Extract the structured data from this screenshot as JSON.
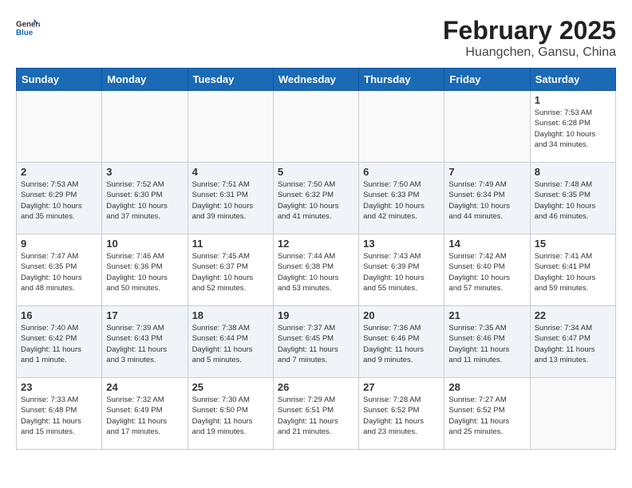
{
  "header": {
    "logo_general": "General",
    "logo_blue": "Blue",
    "month_title": "February 2025",
    "location": "Huangchen, Gansu, China"
  },
  "weekdays": [
    "Sunday",
    "Monday",
    "Tuesday",
    "Wednesday",
    "Thursday",
    "Friday",
    "Saturday"
  ],
  "weeks": [
    [
      {
        "day": "",
        "info": ""
      },
      {
        "day": "",
        "info": ""
      },
      {
        "day": "",
        "info": ""
      },
      {
        "day": "",
        "info": ""
      },
      {
        "day": "",
        "info": ""
      },
      {
        "day": "",
        "info": ""
      },
      {
        "day": "1",
        "info": "Sunrise: 7:53 AM\nSunset: 6:28 PM\nDaylight: 10 hours\nand 34 minutes."
      }
    ],
    [
      {
        "day": "2",
        "info": "Sunrise: 7:53 AM\nSunset: 6:29 PM\nDaylight: 10 hours\nand 35 minutes."
      },
      {
        "day": "3",
        "info": "Sunrise: 7:52 AM\nSunset: 6:30 PM\nDaylight: 10 hours\nand 37 minutes."
      },
      {
        "day": "4",
        "info": "Sunrise: 7:51 AM\nSunset: 6:31 PM\nDaylight: 10 hours\nand 39 minutes."
      },
      {
        "day": "5",
        "info": "Sunrise: 7:50 AM\nSunset: 6:32 PM\nDaylight: 10 hours\nand 41 minutes."
      },
      {
        "day": "6",
        "info": "Sunrise: 7:50 AM\nSunset: 6:33 PM\nDaylight: 10 hours\nand 42 minutes."
      },
      {
        "day": "7",
        "info": "Sunrise: 7:49 AM\nSunset: 6:34 PM\nDaylight: 10 hours\nand 44 minutes."
      },
      {
        "day": "8",
        "info": "Sunrise: 7:48 AM\nSunset: 6:35 PM\nDaylight: 10 hours\nand 46 minutes."
      }
    ],
    [
      {
        "day": "9",
        "info": "Sunrise: 7:47 AM\nSunset: 6:35 PM\nDaylight: 10 hours\nand 48 minutes."
      },
      {
        "day": "10",
        "info": "Sunrise: 7:46 AM\nSunset: 6:36 PM\nDaylight: 10 hours\nand 50 minutes."
      },
      {
        "day": "11",
        "info": "Sunrise: 7:45 AM\nSunset: 6:37 PM\nDaylight: 10 hours\nand 52 minutes."
      },
      {
        "day": "12",
        "info": "Sunrise: 7:44 AM\nSunset: 6:38 PM\nDaylight: 10 hours\nand 53 minutes."
      },
      {
        "day": "13",
        "info": "Sunrise: 7:43 AM\nSunset: 6:39 PM\nDaylight: 10 hours\nand 55 minutes."
      },
      {
        "day": "14",
        "info": "Sunrise: 7:42 AM\nSunset: 6:40 PM\nDaylight: 10 hours\nand 57 minutes."
      },
      {
        "day": "15",
        "info": "Sunrise: 7:41 AM\nSunset: 6:41 PM\nDaylight: 10 hours\nand 59 minutes."
      }
    ],
    [
      {
        "day": "16",
        "info": "Sunrise: 7:40 AM\nSunset: 6:42 PM\nDaylight: 11 hours\nand 1 minute."
      },
      {
        "day": "17",
        "info": "Sunrise: 7:39 AM\nSunset: 6:43 PM\nDaylight: 11 hours\nand 3 minutes."
      },
      {
        "day": "18",
        "info": "Sunrise: 7:38 AM\nSunset: 6:44 PM\nDaylight: 11 hours\nand 5 minutes."
      },
      {
        "day": "19",
        "info": "Sunrise: 7:37 AM\nSunset: 6:45 PM\nDaylight: 11 hours\nand 7 minutes."
      },
      {
        "day": "20",
        "info": "Sunrise: 7:36 AM\nSunset: 6:46 PM\nDaylight: 11 hours\nand 9 minutes."
      },
      {
        "day": "21",
        "info": "Sunrise: 7:35 AM\nSunset: 6:46 PM\nDaylight: 11 hours\nand 11 minutes."
      },
      {
        "day": "22",
        "info": "Sunrise: 7:34 AM\nSunset: 6:47 PM\nDaylight: 11 hours\nand 13 minutes."
      }
    ],
    [
      {
        "day": "23",
        "info": "Sunrise: 7:33 AM\nSunset: 6:48 PM\nDaylight: 11 hours\nand 15 minutes."
      },
      {
        "day": "24",
        "info": "Sunrise: 7:32 AM\nSunset: 6:49 PM\nDaylight: 11 hours\nand 17 minutes."
      },
      {
        "day": "25",
        "info": "Sunrise: 7:30 AM\nSunset: 6:50 PM\nDaylight: 11 hours\nand 19 minutes."
      },
      {
        "day": "26",
        "info": "Sunrise: 7:29 AM\nSunset: 6:51 PM\nDaylight: 11 hours\nand 21 minutes."
      },
      {
        "day": "27",
        "info": "Sunrise: 7:28 AM\nSunset: 6:52 PM\nDaylight: 11 hours\nand 23 minutes."
      },
      {
        "day": "28",
        "info": "Sunrise: 7:27 AM\nSunset: 6:52 PM\nDaylight: 11 hours\nand 25 minutes."
      },
      {
        "day": "",
        "info": ""
      }
    ]
  ]
}
